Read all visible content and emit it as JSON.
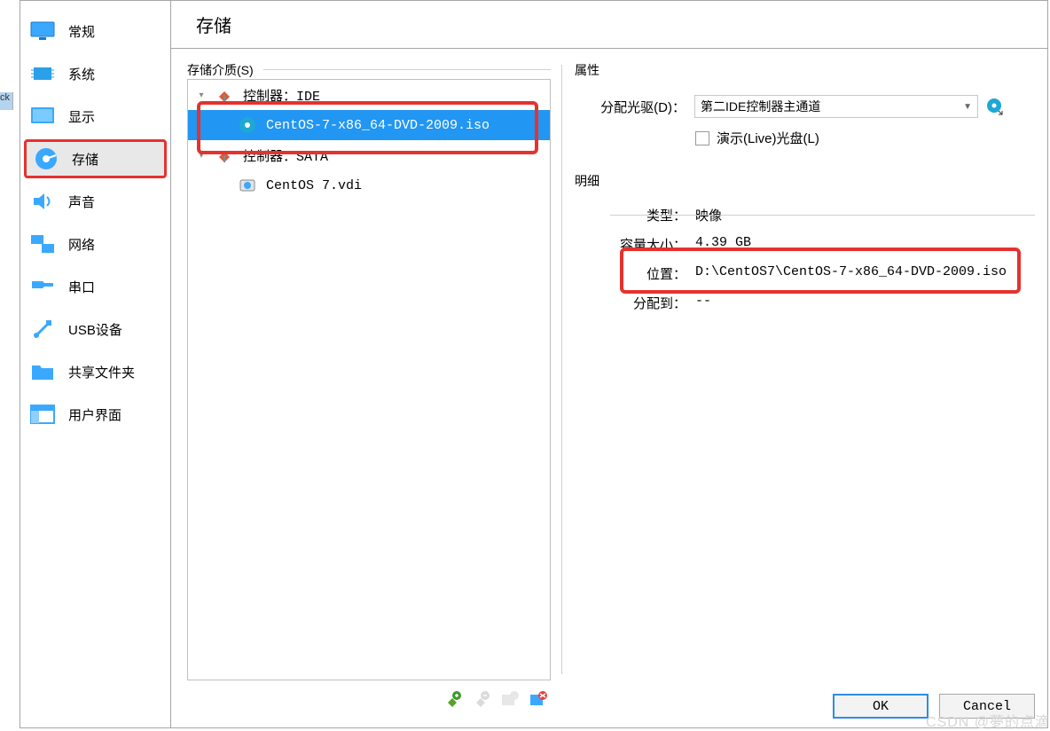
{
  "sidebar": {
    "items": [
      {
        "label": "常规",
        "icon": "monitor-icon"
      },
      {
        "label": "系统",
        "icon": "chip-icon"
      },
      {
        "label": "显示",
        "icon": "display-icon"
      },
      {
        "label": "存储",
        "icon": "storage-icon",
        "selected": true
      },
      {
        "label": "声音",
        "icon": "audio-icon"
      },
      {
        "label": "网络",
        "icon": "network-icon"
      },
      {
        "label": "串口",
        "icon": "serial-icon"
      },
      {
        "label": "USB设备",
        "icon": "usb-icon"
      },
      {
        "label": "共享文件夹",
        "icon": "folder-icon"
      },
      {
        "label": "用户界面",
        "icon": "ui-icon"
      }
    ]
  },
  "header": {
    "title": "存储"
  },
  "storage": {
    "legend": "存储介质(S)",
    "tree": {
      "ide": {
        "label": "控制器：IDE"
      },
      "iso": {
        "label": "CentOS-7-x86_64-DVD-2009.iso"
      },
      "sata": {
        "label": "控制器：SATA"
      },
      "vdi": {
        "label": "CentOS 7.vdi"
      }
    }
  },
  "attributes": {
    "legend": "属性",
    "drive_label": "分配光驱(D)：",
    "drive_value": "第二IDE控制器主通道",
    "live_label": "演示(Live)光盘(L)"
  },
  "details": {
    "legend": "明细",
    "type_label": "类型：",
    "type_value": "映像",
    "size_label": "容量大小：",
    "size_value": "4.39 GB",
    "location_label": "位置：",
    "location_value": "D:\\CentOS7\\CentOS-7-x86_64-DVD-2009.iso",
    "attached_label": "分配到：",
    "attached_value": "--"
  },
  "buttons": {
    "ok": "OK",
    "cancel": "Cancel"
  },
  "watermark": "CSDN @夢的点滴",
  "left_strip": "ck"
}
